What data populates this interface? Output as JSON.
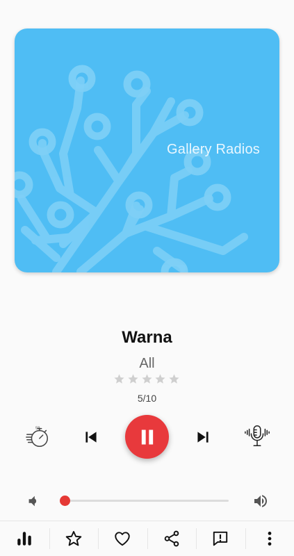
{
  "artwork": {
    "label": "Gallery Radios",
    "background_color": "#4fbdf4",
    "motif": "tree-circuit-icon"
  },
  "station": {
    "name": "Warna",
    "genre": "All",
    "rating": 0,
    "rating_max": 5,
    "position": "5/10"
  },
  "controls": {
    "sleep_timer": "sleep-timer-icon",
    "previous": "skip-previous-icon",
    "play_state": "playing",
    "play_pause": "pause-icon",
    "next": "skip-next-icon",
    "voice": "microphone-icon"
  },
  "volume": {
    "level": 0,
    "down_icon": "volume-down-icon",
    "up_icon": "volume-up-icon",
    "accent_color": "#e53935"
  },
  "bottom_bar": {
    "items": [
      "equalizer-icon",
      "star-icon",
      "heart-icon",
      "share-icon",
      "report-icon",
      "more-vert-icon"
    ]
  },
  "colors": {
    "accent": "#e8393c",
    "star_empty": "#cfcfcf"
  }
}
